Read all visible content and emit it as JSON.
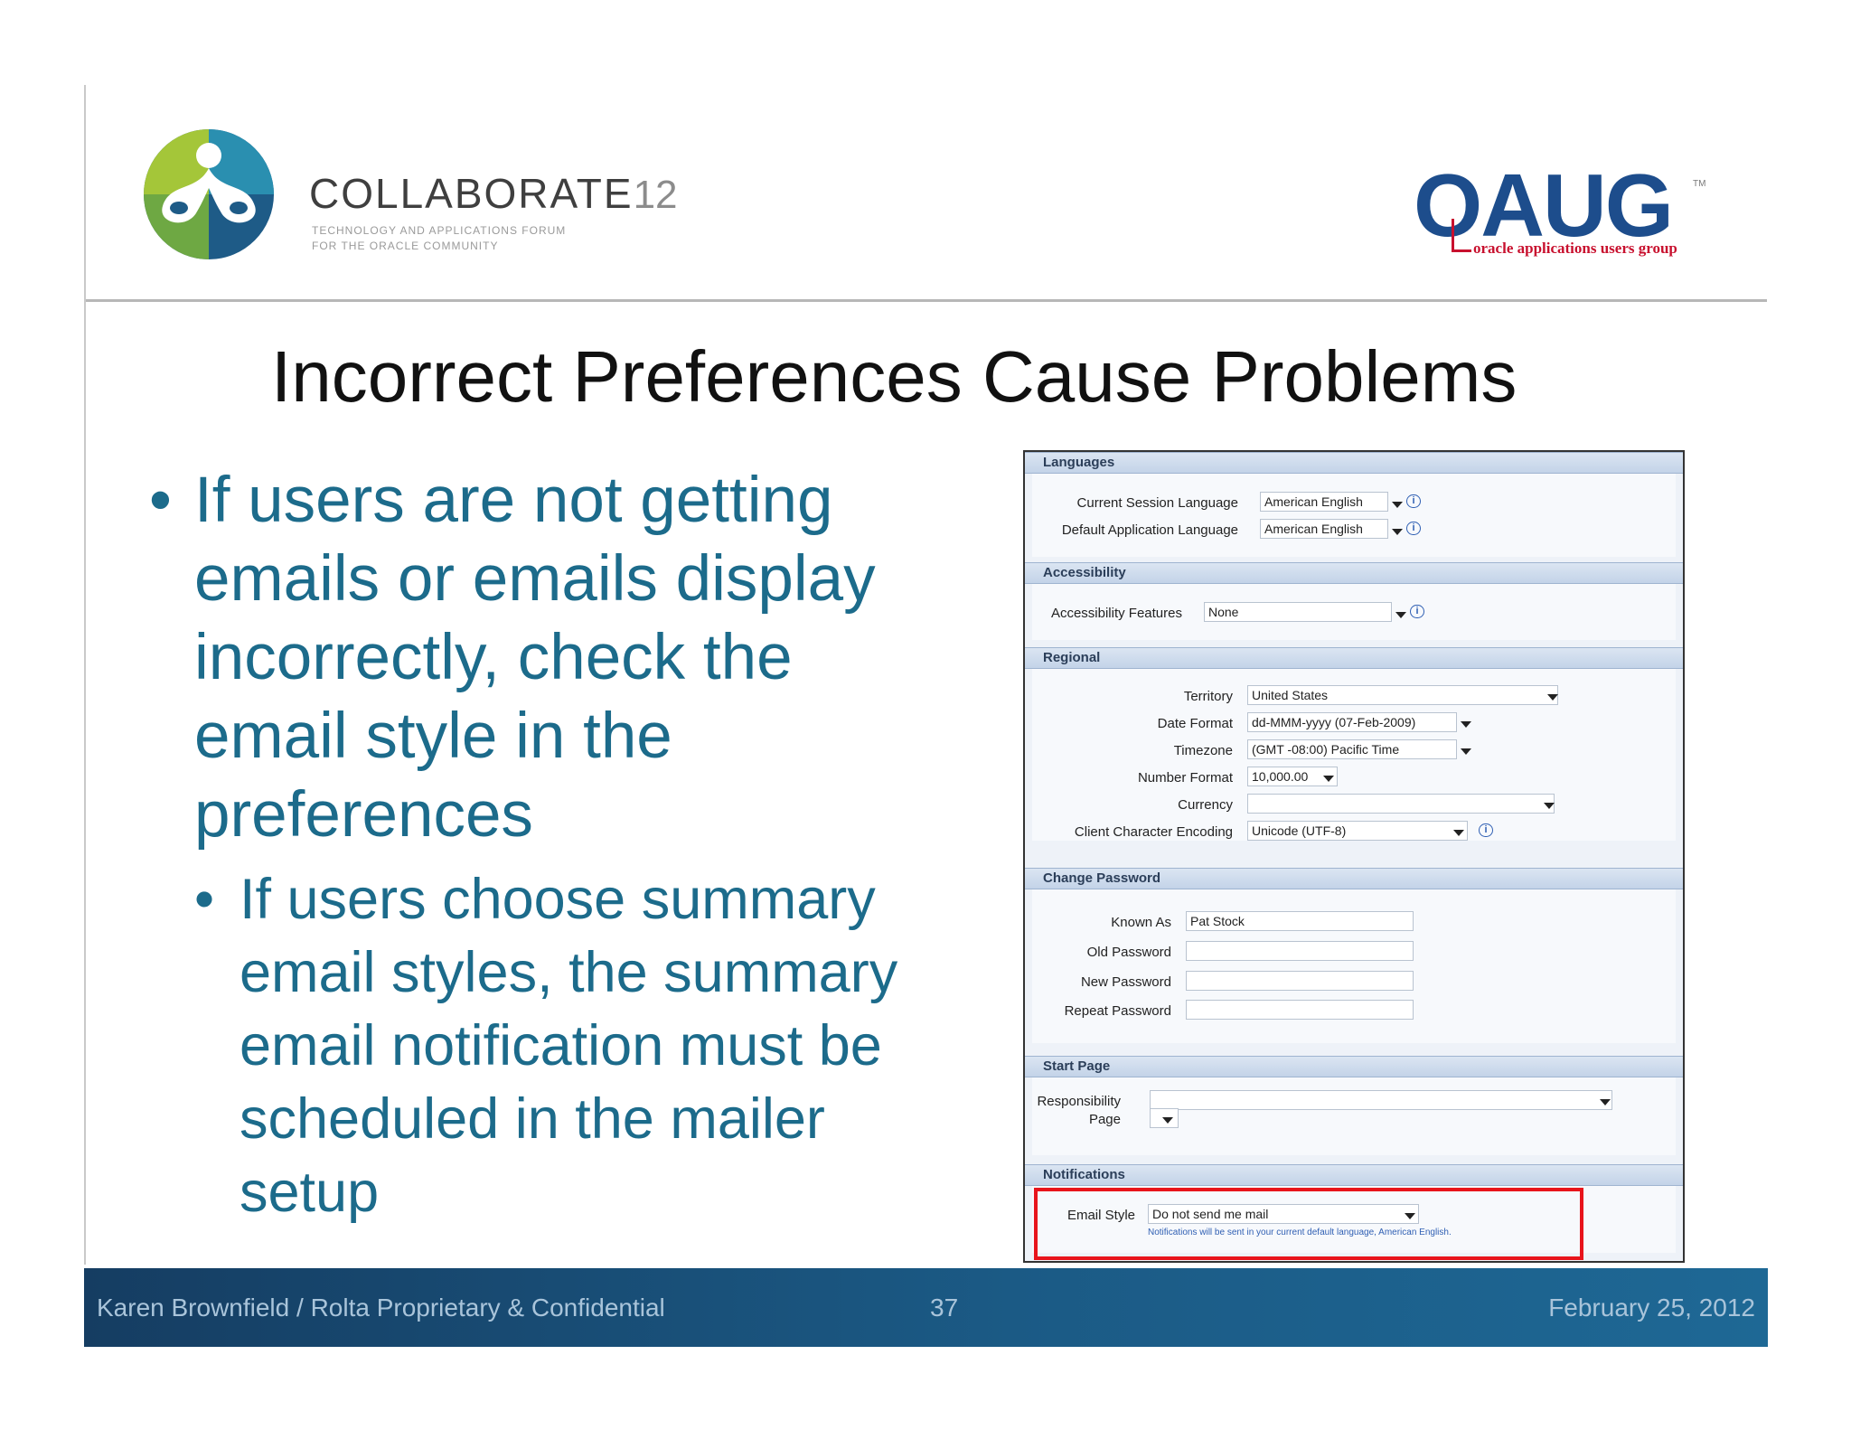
{
  "header": {
    "collab_brand": "COLLABORATE",
    "collab_year": "12",
    "collab_tagline_1": "TECHNOLOGY AND APPLICATIONS FORUM",
    "collab_tagline_2": "FOR THE ORACLE COMMUNITY",
    "oaug_brand": "OAUG",
    "oaug_tm": "TM",
    "oaug_sub": "oracle applications users group"
  },
  "slide": {
    "title": "Incorrect Preferences Cause Problems",
    "bullet_main": "If users are not getting emails or emails display incorrectly, check the email style in the preferences",
    "bullet_sub": "If users choose summary email styles, the summary email notification must be scheduled in the mailer setup",
    "bullet_glyph": "•"
  },
  "prefs": {
    "languages": {
      "header": "Languages",
      "current_session_label": "Current Session Language",
      "current_session_value": "American English",
      "default_app_label": "Default Application Language",
      "default_app_value": "American English"
    },
    "accessibility": {
      "header": "Accessibility",
      "features_label": "Accessibility Features",
      "features_value": "None"
    },
    "regional": {
      "header": "Regional",
      "territory_label": "Territory",
      "territory_value": "United States",
      "date_format_label": "Date Format",
      "date_format_value": "dd-MMM-yyyy (07-Feb-2009)",
      "timezone_label": "Timezone",
      "timezone_value": "(GMT -08:00) Pacific Time",
      "number_format_label": "Number Format",
      "number_format_value": "10,000.00",
      "currency_label": "Currency",
      "currency_value": "",
      "encoding_label": "Client Character Encoding",
      "encoding_value": "Unicode (UTF-8)"
    },
    "change_password": {
      "header": "Change Password",
      "known_as_label": "Known As",
      "known_as_value": "Pat Stock",
      "old_password_label": "Old Password",
      "new_password_label": "New Password",
      "repeat_password_label": "Repeat Password"
    },
    "start_page": {
      "header": "Start Page",
      "responsibility_label": "Responsibility",
      "page_label": "Page"
    },
    "notifications": {
      "header": "Notifications",
      "email_style_label": "Email Style",
      "email_style_value": "Do not send me mail",
      "note": "Notifications will be sent in your current default language, American English."
    }
  },
  "footer": {
    "left": "Karen Brownfield  /  Rolta  Proprietary & Confidential",
    "page_number": "37",
    "date": "February 25, 2012"
  },
  "colors": {
    "accent_text": "#1c6b8b",
    "footer_bg": "#1b5a85",
    "highlight": "#e8141b",
    "oaug_blue": "#1d4d8c"
  }
}
